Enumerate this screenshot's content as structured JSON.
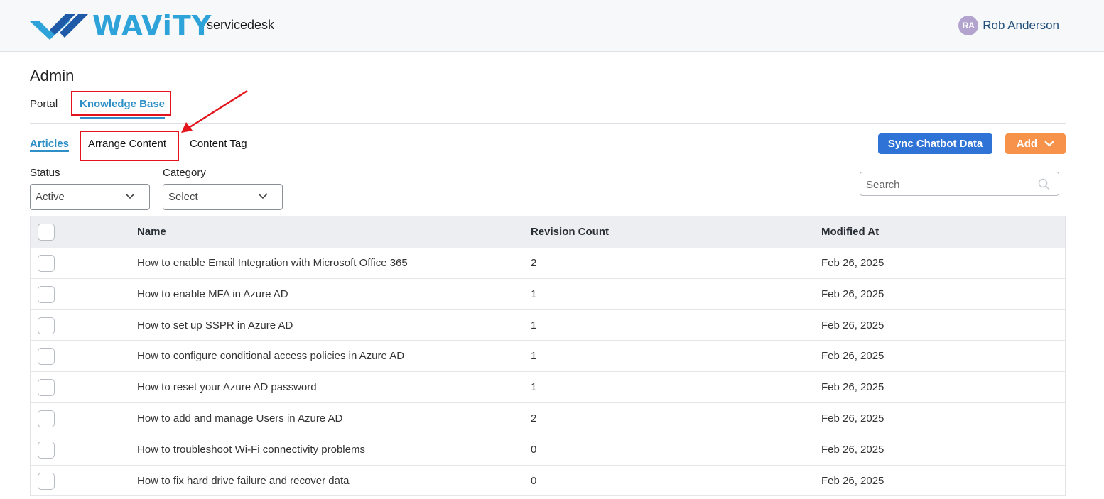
{
  "header": {
    "logo_text": "WAViTY",
    "app_name": "servicedesk",
    "user": {
      "initials": "RA",
      "name": "Rob Anderson"
    },
    "brand_color": "#2ea3d9"
  },
  "page": {
    "title": "Admin"
  },
  "tabs": [
    {
      "label": "Portal",
      "active": false
    },
    {
      "label": "Knowledge Base",
      "active": true
    }
  ],
  "subtabs": [
    {
      "label": "Articles",
      "active": true
    },
    {
      "label": "Arrange Content",
      "active": false
    },
    {
      "label": "Content Tag",
      "active": false
    }
  ],
  "actions": {
    "sync_label": "Sync Chatbot Data",
    "add_label": "Add",
    "sync_color": "#2f73d6",
    "add_color": "#f7924a"
  },
  "filters": {
    "status": {
      "label": "Status",
      "value": "Active"
    },
    "category": {
      "label": "Category",
      "value": "Select"
    }
  },
  "search": {
    "placeholder": "Search"
  },
  "table": {
    "columns": [
      "Name",
      "Revision Count",
      "Modified At"
    ],
    "rows": [
      {
        "name": "How to enable Email Integration with Microsoft Office 365",
        "revisions": "2",
        "modified": "Feb 26, 2025"
      },
      {
        "name": "How to enable MFA in Azure AD",
        "revisions": "1",
        "modified": "Feb 26, 2025"
      },
      {
        "name": "How to set up SSPR in Azure AD",
        "revisions": "1",
        "modified": "Feb 26, 2025"
      },
      {
        "name": "How to configure conditional access policies in Azure AD",
        "revisions": "1",
        "modified": "Feb 26, 2025"
      },
      {
        "name": "How to reset your Azure AD password",
        "revisions": "1",
        "modified": "Feb 26, 2025"
      },
      {
        "name": "How to add and manage Users in Azure AD",
        "revisions": "2",
        "modified": "Feb 26, 2025"
      },
      {
        "name": "How to troubleshoot Wi-Fi connectivity problems",
        "revisions": "0",
        "modified": "Feb 26, 2025"
      },
      {
        "name": "How to fix hard drive failure and recover data",
        "revisions": "0",
        "modified": "Feb 26, 2025"
      }
    ]
  },
  "annotation_color": "#e3141b"
}
